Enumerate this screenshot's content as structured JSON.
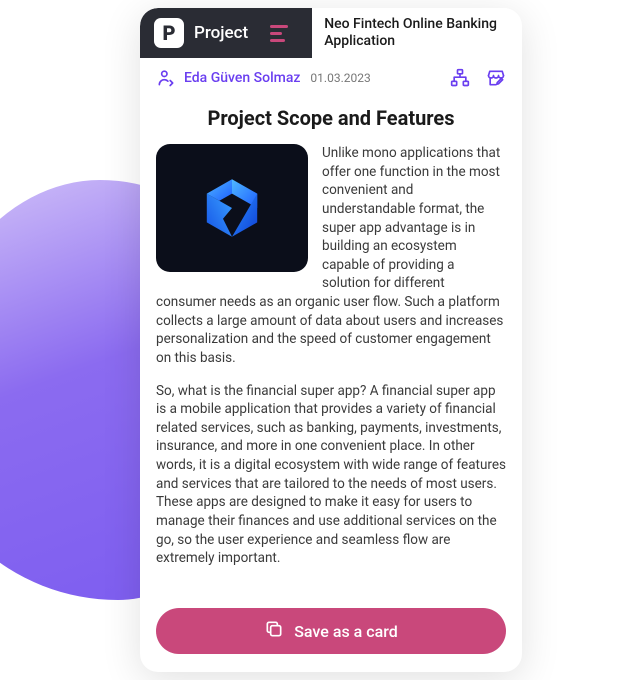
{
  "header": {
    "app_label": "Project",
    "project_title": "Neo Fintech Online Banking Application"
  },
  "meta": {
    "author": "Eda Güven Solmaz",
    "date": "01.03.2023"
  },
  "page": {
    "title": "Project Scope and Features",
    "paragraph1": "Unlike mono applications that offer one function in the most convenient and understandable format, the super app advantage is in building an ecosystem capable of providing a solution for different consumer needs as an organic user flow. Such a platform collects a large amount of data about users and increases personalization and the speed of customer engagement on this basis.",
    "paragraph2": "So, what is the financial super app? A financial super app is a mobile application that provides a variety of financial related services, such as banking, payments, investments, insurance, and more in one convenient place. In other words, it is a digital ecosystem with wide range of features and services that are tailored to the needs of most users. These apps are designed to make it easy for users to manage their finances and use additional services on the go, so the user experience and seamless flow are extremely important."
  },
  "actions": {
    "save_label": "Save as a card"
  },
  "colors": {
    "accent": "#6a3ef0",
    "action": "#c9487b",
    "header_dark": "#2a2c34"
  }
}
